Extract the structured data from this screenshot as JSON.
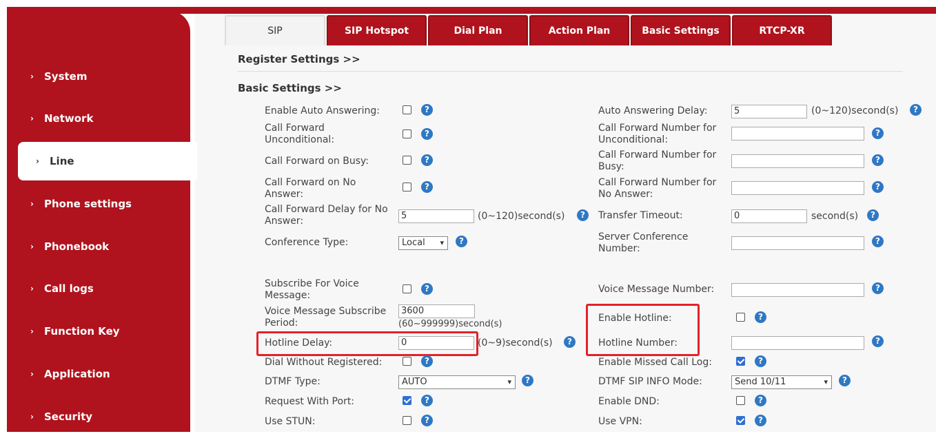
{
  "sidebar": {
    "items": [
      {
        "label": "System"
      },
      {
        "label": "Network"
      },
      {
        "label": "Line"
      },
      {
        "label": "Phone settings"
      },
      {
        "label": "Phonebook"
      },
      {
        "label": "Call logs"
      },
      {
        "label": "Function Key"
      },
      {
        "label": "Application"
      },
      {
        "label": "Security"
      }
    ],
    "active": "Line"
  },
  "tabs": [
    "SIP",
    "SIP Hotspot",
    "Dial Plan",
    "Action Plan",
    "Basic Settings",
    "RTCP-XR"
  ],
  "active_tab": "SIP",
  "sections": {
    "register": "Register Settings >>",
    "basic": "Basic Settings >>"
  },
  "help_glyph": "?",
  "left": {
    "auto_answer": {
      "label": "Enable Auto Answering:",
      "checked": false
    },
    "cf_uncond": {
      "label": "Call Forward Unconditional:",
      "checked": false
    },
    "cf_busy": {
      "label": "Call Forward on Busy:",
      "checked": false
    },
    "cf_noanswer": {
      "label": "Call Forward on No Answer:",
      "checked": false
    },
    "cf_delay": {
      "label": "Call Forward Delay for No Answer:",
      "value": "5",
      "unit": "(0~120)second(s)"
    },
    "conf_type": {
      "label": "Conference Type:",
      "value": "Local"
    },
    "subscribe_vm": {
      "label": "Subscribe For Voice Message:",
      "checked": false
    },
    "vm_period": {
      "label": "Voice Message Subscribe Period:",
      "value": "3600",
      "unit": "(60~999999)second(s)"
    },
    "hotline_delay": {
      "label": "Hotline Delay:",
      "value": "0",
      "unit": "(0~9)second(s)"
    },
    "dial_wo_reg": {
      "label": "Dial Without Registered:",
      "checked": false
    },
    "dtmf_type": {
      "label": "DTMF Type:",
      "value": "AUTO"
    },
    "req_port": {
      "label": "Request With Port:",
      "checked": true
    },
    "use_stun": {
      "label": "Use STUN:",
      "checked": false
    }
  },
  "right": {
    "aa_delay": {
      "label": "Auto Answering Delay:",
      "value": "5",
      "unit": "(0~120)second(s)"
    },
    "cfn_uncond": {
      "label": "Call Forward Number for Unconditional:",
      "value": ""
    },
    "cfn_busy": {
      "label": "Call Forward Number for Busy:",
      "value": ""
    },
    "cfn_noanswer": {
      "label": "Call Forward Number for No Answer:",
      "value": ""
    },
    "transfer_timeout": {
      "label": "Transfer Timeout:",
      "value": "0",
      "unit": "second(s)"
    },
    "server_conf": {
      "label": "Server Conference Number:",
      "value": ""
    },
    "vm_number": {
      "label": "Voice Message Number:",
      "value": ""
    },
    "enable_hotline": {
      "label": "Enable Hotline:",
      "checked": false
    },
    "hotline_number": {
      "label": "Hotline Number:",
      "value": ""
    },
    "missed_log": {
      "label": "Enable Missed Call Log:",
      "checked": true
    },
    "dtmf_sip_info": {
      "label": "DTMF SIP INFO Mode:",
      "value": "Send 10/11"
    },
    "enable_dnd": {
      "label": "Enable DND:",
      "checked": false
    },
    "use_vpn": {
      "label": "Use VPN:",
      "checked": true
    }
  }
}
